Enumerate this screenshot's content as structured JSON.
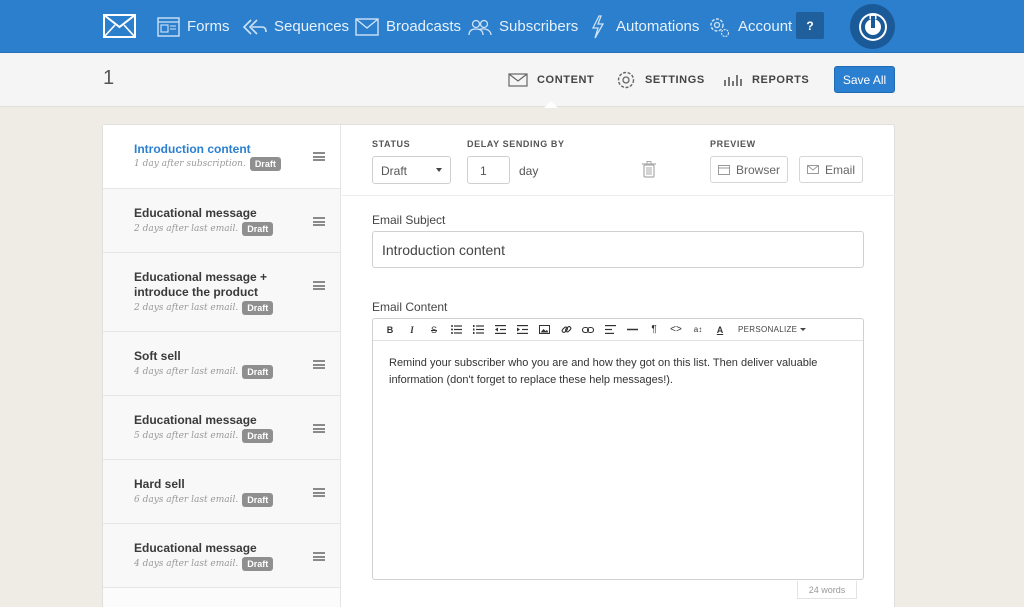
{
  "nav": {
    "items": [
      {
        "label": "Forms",
        "icon": "form-icon"
      },
      {
        "label": "Sequences",
        "icon": "sequences-icon"
      },
      {
        "label": "Broadcasts",
        "icon": "envelope-icon"
      },
      {
        "label": "Subscribers",
        "icon": "users-icon"
      },
      {
        "label": "Automations",
        "icon": "lightning-icon"
      },
      {
        "label": "Account",
        "icon": "gear-icon"
      }
    ],
    "help_label": "?"
  },
  "subheader": {
    "title": "1",
    "tabs": [
      {
        "label": "CONTENT",
        "icon": "envelope-icon",
        "active": true
      },
      {
        "label": "SETTINGS",
        "icon": "gear-icon",
        "active": false
      },
      {
        "label": "REPORTS",
        "icon": "bar-chart-icon",
        "active": false
      }
    ],
    "save_label": "Save All"
  },
  "emails": [
    {
      "title": "Introduction content",
      "meta": "1 day after subscription.",
      "badge": "Draft",
      "active": true
    },
    {
      "title": "Educational message",
      "meta": "2 days after last email.",
      "badge": "Draft",
      "active": false
    },
    {
      "title": "Educational message + introduce the product",
      "meta": "2 days after last email.",
      "badge": "Draft",
      "active": false
    },
    {
      "title": "Soft sell",
      "meta": "4 days after last email.",
      "badge": "Draft",
      "active": false
    },
    {
      "title": "Educational message",
      "meta": "5 days after last email.",
      "badge": "Draft",
      "active": false
    },
    {
      "title": "Hard sell",
      "meta": "6 days after last email.",
      "badge": "Draft",
      "active": false
    },
    {
      "title": "Educational message",
      "meta": "4 days after last email.",
      "badge": "Draft",
      "active": false
    }
  ],
  "editor": {
    "status_label": "STATUS",
    "status_value": "Draft",
    "delay_label": "DELAY SENDING BY",
    "delay_value": "1",
    "delay_unit": "day",
    "preview_label": "PREVIEW",
    "preview_browser": "Browser",
    "preview_email": "Email",
    "subject_label": "Email Subject",
    "subject_value": "Introduction content",
    "content_label": "Email Content",
    "personalize_label": "PERSONALIZE",
    "body": "Remind your subscriber who you are and how they got on this list. Then deliver valuable information (don't forget to replace these help messages!).",
    "word_count": "24 words"
  },
  "colors": {
    "nav_bg": "#2c7fcc",
    "accent": "#2b7fd0",
    "badge": "#8f8f8f",
    "page_bg": "#efece6"
  }
}
